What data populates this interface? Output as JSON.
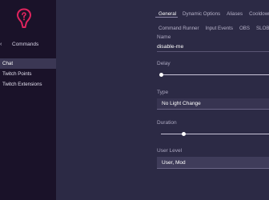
{
  "sidebar": {
    "commands_label": "Commands",
    "chevron": "‹",
    "items": [
      {
        "label": "Chat",
        "active": true
      },
      {
        "label": "Twitch Points",
        "active": false
      },
      {
        "label": "Twitch Extensions",
        "active": false
      }
    ]
  },
  "tabs": {
    "row1": [
      "General",
      "Dynamic Options",
      "Aliases",
      "Cooldown"
    ],
    "row2": [
      "Command Runner",
      "Input Events",
      "OBS",
      "SLOBS"
    ],
    "active": "General"
  },
  "form": {
    "name_label": "Name",
    "name_value": "disable-me",
    "delay_label": "Delay",
    "delay_value": 0,
    "type_label": "Type",
    "type_value": "No Light Change",
    "duration_label": "Duration",
    "duration_value_fraction": 0.2,
    "user_level_label": "User Level",
    "user_level_value": "User, Mod"
  },
  "colors": {
    "sidebar_bg": "#1a1229",
    "main_bg": "#2c2a45",
    "logo_accent": "#e0245e"
  }
}
